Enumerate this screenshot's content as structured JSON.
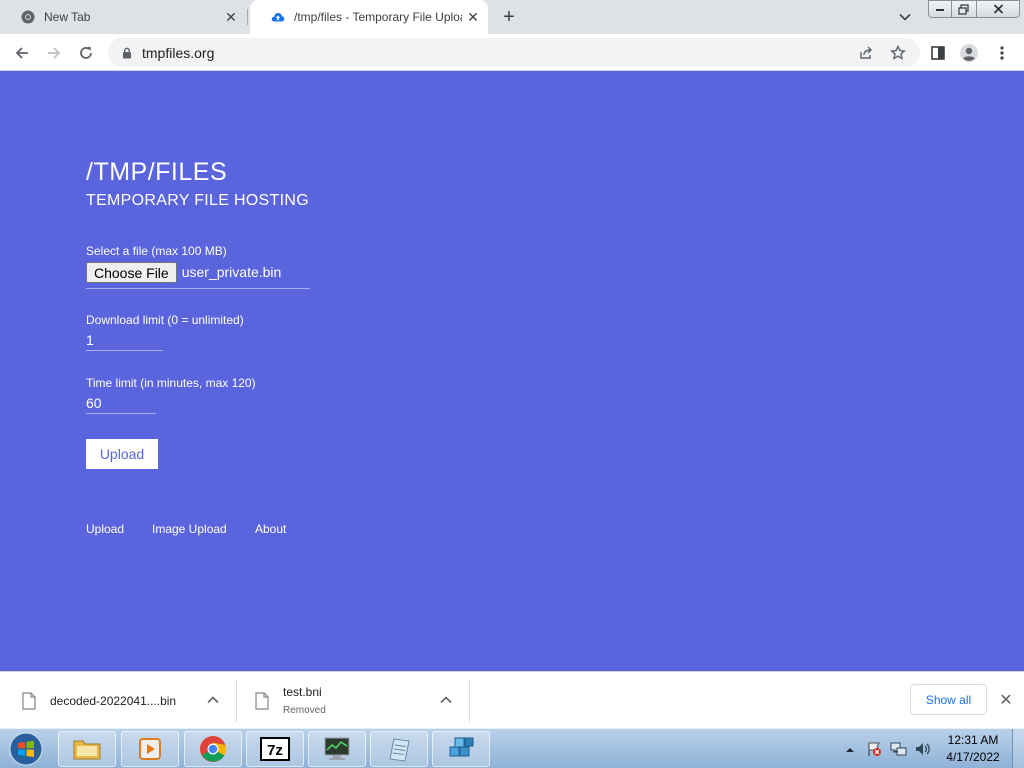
{
  "browser": {
    "tabs": [
      {
        "title": "New Tab",
        "active": false
      },
      {
        "title": "/tmp/files - Temporary File Uploa",
        "active": true
      }
    ],
    "new_tab_label": "+",
    "url": "tmpfiles.org"
  },
  "page": {
    "title": "/TMP/FILES",
    "subtitle": "TEMPORARY FILE HOSTING",
    "file_label": "Select a file (max 100 MB)",
    "choose_file_label": "Choose File",
    "selected_file": "user_private.bin",
    "download_limit_label": "Download limit (0 = unlimited)",
    "download_limit_value": "1",
    "time_limit_label": "Time limit (in minutes, max 120)",
    "time_limit_value": "60",
    "upload_button": "Upload",
    "nav": [
      "Upload",
      "Image Upload",
      "About"
    ],
    "background_color": "#5a64dc"
  },
  "downloads": {
    "items": [
      {
        "name": "decoded-2022041....bin",
        "status": ""
      },
      {
        "name": "test.bni",
        "status": "Removed"
      }
    ],
    "show_all": "Show all",
    "close": "✕"
  },
  "taskbar": {
    "apps": [
      "windows-explorer",
      "media-player",
      "chrome",
      "7-zip",
      "system-monitor",
      "notepad",
      "package-app"
    ],
    "time": "12:31 AM",
    "date": "4/17/2022"
  }
}
